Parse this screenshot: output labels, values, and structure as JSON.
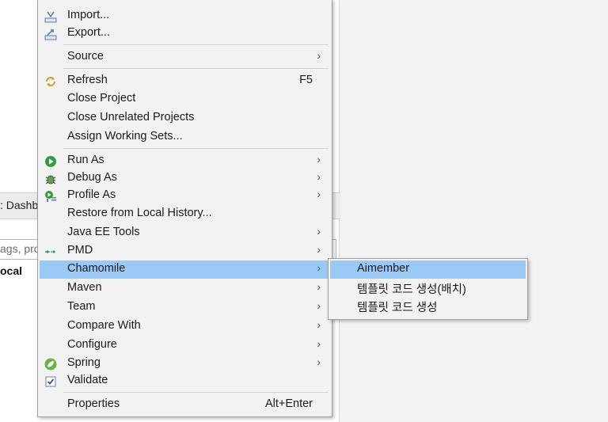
{
  "background": {
    "tab_label": ": Dashb",
    "search_placeholder": "ags, pro",
    "bold_item": "ocal"
  },
  "context_menu": {
    "items": [
      {
        "label": "Import...",
        "icon": "import-icon"
      },
      {
        "label": "Export...",
        "icon": "export-icon"
      },
      {
        "label": "Source",
        "submenu": true
      },
      {
        "label": "Refresh",
        "icon": "refresh-icon",
        "accelerator": "F5"
      },
      {
        "label": "Close Project"
      },
      {
        "label": "Close Unrelated Projects"
      },
      {
        "label": "Assign Working Sets..."
      },
      {
        "label": "Run As",
        "icon": "run-icon",
        "submenu": true
      },
      {
        "label": "Debug As",
        "icon": "debug-icon",
        "submenu": true
      },
      {
        "label": "Profile As",
        "icon": "profile-icon",
        "submenu": true
      },
      {
        "label": "Restore from Local History..."
      },
      {
        "label": "Java EE Tools",
        "submenu": true
      },
      {
        "label": "PMD",
        "icon": "pmd-icon",
        "submenu": true
      },
      {
        "label": "Chamomile",
        "submenu": true,
        "highlighted": true
      },
      {
        "label": "Maven",
        "submenu": true
      },
      {
        "label": "Team",
        "submenu": true
      },
      {
        "label": "Compare With",
        "submenu": true
      },
      {
        "label": "Configure",
        "submenu": true
      },
      {
        "label": "Spring",
        "icon": "spring-icon",
        "submenu": true
      },
      {
        "label": "Validate",
        "icon": "validate-checkbox-icon"
      },
      {
        "label": "Properties",
        "accelerator": "Alt+Enter"
      }
    ]
  },
  "submenu": {
    "items": [
      {
        "label": "Aimember",
        "highlighted": true
      },
      {
        "label": "템플릿 코드 생성(배치)"
      },
      {
        "label": "템플릿 코드 생성"
      }
    ]
  },
  "colors": {
    "highlight": "#99c9f7",
    "menu_bg": "#f2f2f2",
    "run_green": "#2e9e3e",
    "spring_green": "#6db33f"
  }
}
